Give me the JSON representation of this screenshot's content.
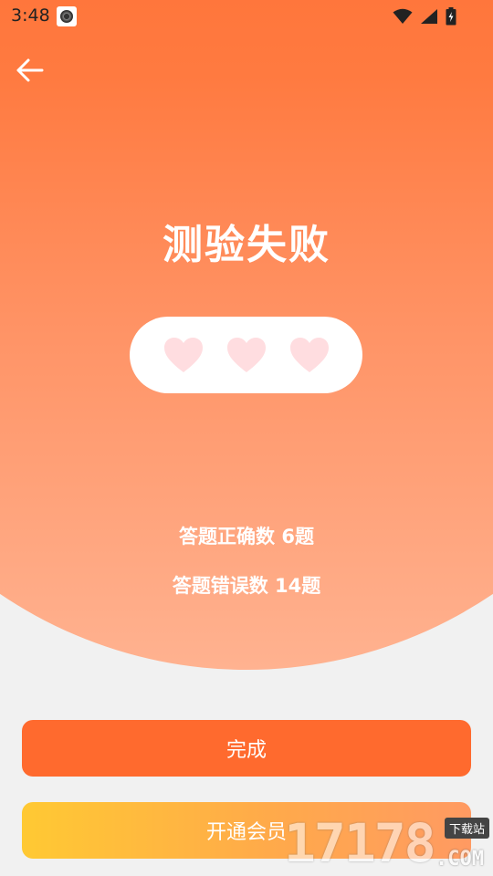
{
  "status_bar": {
    "time": "3:48",
    "icons": [
      "app-qr-icon",
      "wifi-icon",
      "signal-icon",
      "battery-icon"
    ]
  },
  "header": {
    "back_icon": "arrow-left-icon"
  },
  "result": {
    "title": "测验失败",
    "hearts": [
      {
        "icon": "heart-icon",
        "color": "#ffdde0"
      },
      {
        "icon": "heart-icon",
        "color": "#ffdde0"
      },
      {
        "icon": "heart-icon",
        "color": "#ffdde0"
      }
    ],
    "correct_count": "答题正确数 6题",
    "wrong_count": "答题错误数 14题"
  },
  "actions": {
    "done_label": "完成",
    "vip_label": "开通会员"
  },
  "watermark": {
    "digits": "17178",
    "badge": "下载站",
    "suffix": ".COM"
  },
  "colors": {
    "accent": "#ff6a2e",
    "vip_gradient_start": "#ffc933",
    "vip_gradient_end": "#ff9a62",
    "heart": "#ffdde0"
  }
}
